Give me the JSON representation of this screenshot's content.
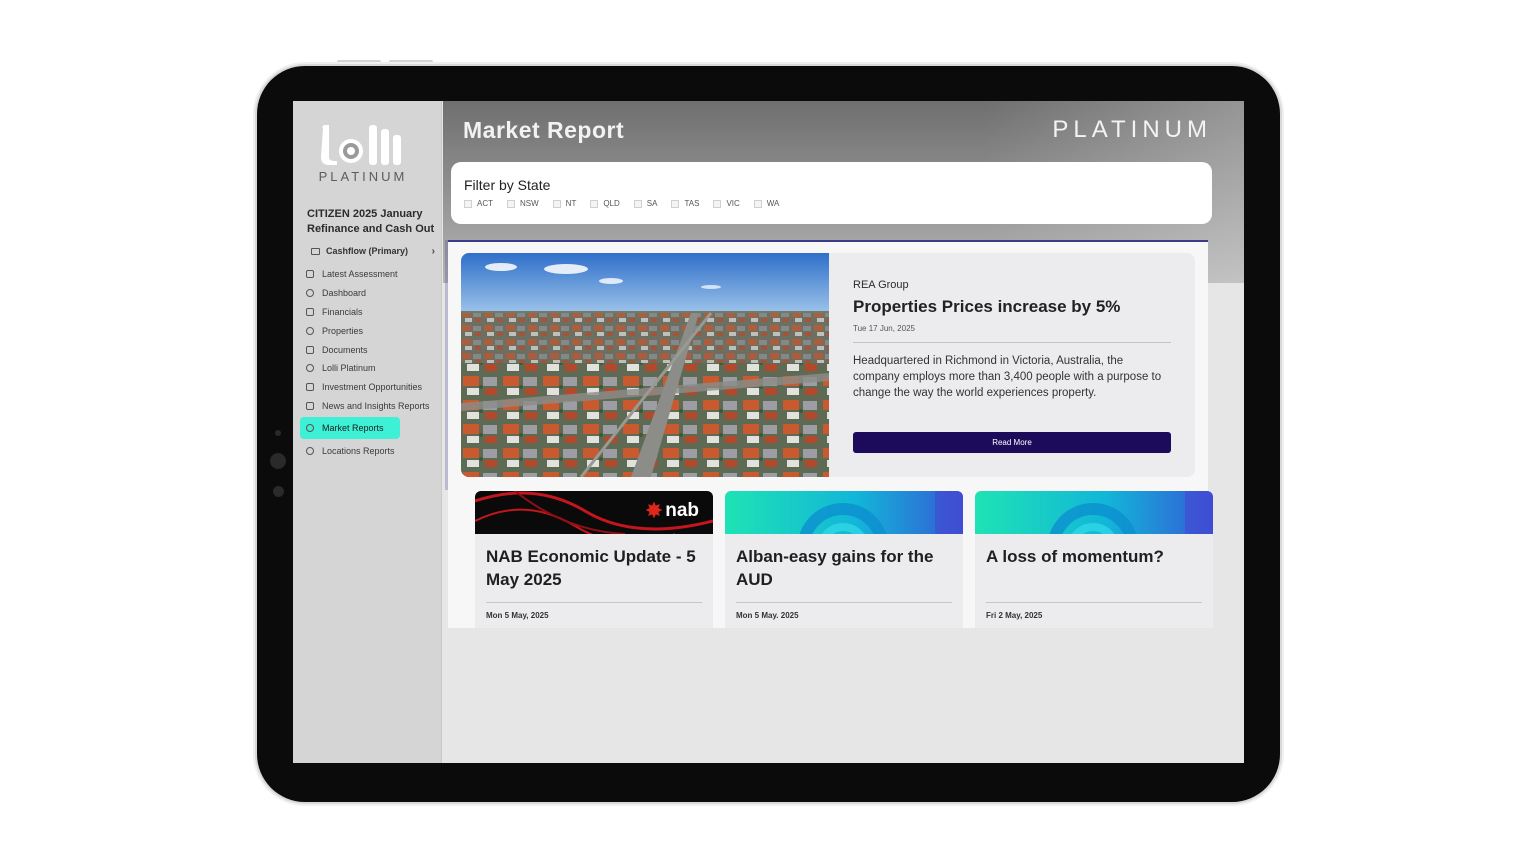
{
  "sidebar": {
    "logo_text": "lolli",
    "logo_sub": "PLATINUM",
    "client_title": "CITIZEN 2025 January Refinance and Cash Out",
    "cashflow": "Cashflow (Primary)",
    "nav": [
      {
        "label": "Latest Assessment",
        "icon": "clipboard-icon"
      },
      {
        "label": "Dashboard",
        "icon": "gauge-icon"
      },
      {
        "label": "Financials",
        "icon": "file-dollar-icon"
      },
      {
        "label": "Properties",
        "icon": "home-icon"
      },
      {
        "label": "Documents",
        "icon": "document-icon"
      },
      {
        "label": "Lolli Platinum",
        "icon": "location-pin-icon"
      },
      {
        "label": "Investment Opportunities",
        "icon": "hand-coin-icon"
      },
      {
        "label": "News and Insights Reports",
        "icon": "newspaper-icon"
      },
      {
        "label": "Market Reports",
        "icon": "search-icon",
        "active": true
      },
      {
        "label": "Locations Reports",
        "icon": "circle-location-icon"
      }
    ]
  },
  "header": {
    "title": "Market Report",
    "brand": "PLATINUM"
  },
  "filter": {
    "title": "Filter by State",
    "states": [
      "ACT",
      "NSW",
      "NT",
      "QLD",
      "SA",
      "TAS",
      "VIC",
      "WA"
    ]
  },
  "featured": {
    "source": "REA Group",
    "title": "Properties Prices increase by 5%",
    "date": "Tue 17 Jun, 2025",
    "body": "Headquartered in Richmond in Victoria, Australia, the company employs more than 3,400 people with a purpose to change the way the world experiences property.",
    "button": "Read More"
  },
  "cards": [
    {
      "title": "NAB Economic Update - 5 May 2025",
      "date": "Mon 5 May, 2025",
      "banner": "nab",
      "banner_text": "nab"
    },
    {
      "title": "Alban-easy gains for the AUD",
      "date": "Mon 5 May. 2025",
      "banner": "teal"
    },
    {
      "title": "A loss of momentum?",
      "date": "Fri 2 May, 2025",
      "banner": "teal"
    }
  ],
  "colors": {
    "accent": "#3ef0d6",
    "button": "#1c0a5a",
    "nab_red": "#e1261c"
  }
}
